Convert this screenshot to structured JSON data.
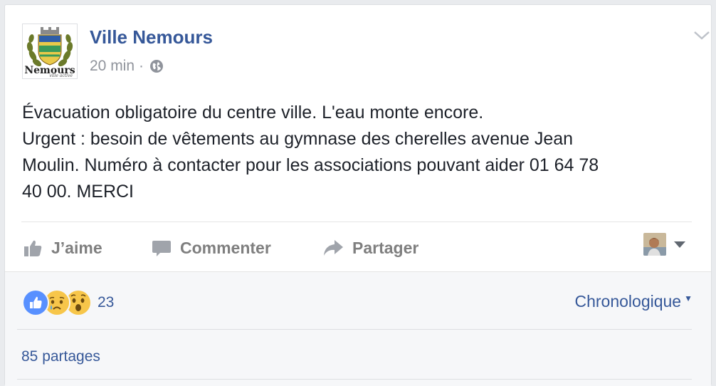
{
  "post": {
    "page_name": "Ville Nemours",
    "logo": {
      "wordmark": "Nemours",
      "tagline": "ville active"
    },
    "time": "20 min",
    "separator": "·",
    "privacy_icon": "globe-icon",
    "menu_icon": "chevron-down-icon",
    "text_lines": [
      "Évacuation obligatoire du centre ville. L'eau monte encore.",
      "Urgent : besoin de vêtements au gymnase des cherelles avenue Jean",
      "Moulin. Numéro à contacter pour les associations pouvant aider 01 64 78",
      "40 00. MERCI"
    ]
  },
  "actions": {
    "like": {
      "label": "J’aime",
      "icon": "thumbs-up-icon"
    },
    "comment": {
      "label": "Commenter",
      "icon": "comment-bubble-icon"
    },
    "share": {
      "label": "Partager",
      "icon": "share-arrow-icon"
    },
    "identity_selector_icon": "caret-down-icon"
  },
  "footer": {
    "reactions": {
      "icons": [
        "like-reaction-icon",
        "sad-reaction-icon",
        "wow-reaction-icon"
      ],
      "count": "23"
    },
    "sort_label": "Chronologique",
    "shares": "85 partages"
  },
  "colors": {
    "link": "#365899",
    "action_gray": "#7f7f7f",
    "meta_gray": "#90949c",
    "text": "#1d2129",
    "background": "#e9ebee"
  }
}
